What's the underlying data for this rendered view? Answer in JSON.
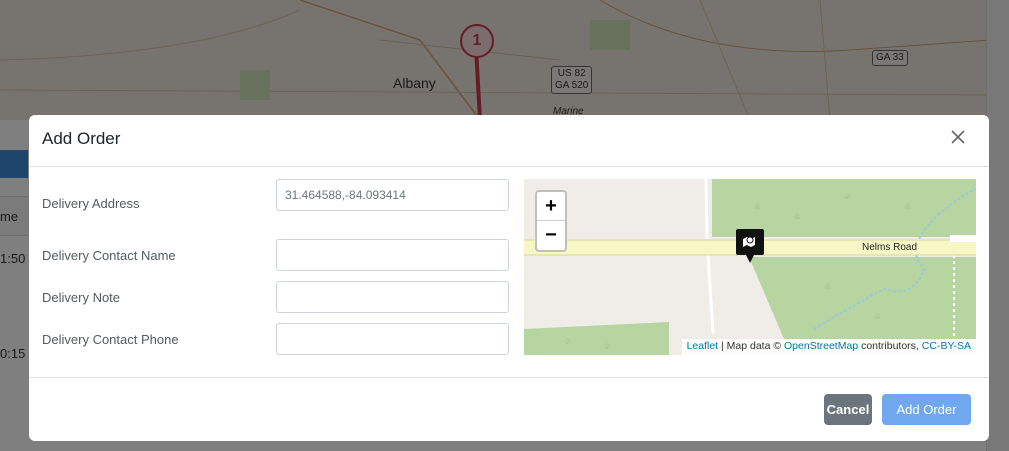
{
  "background": {
    "map_labels": {
      "city": "Albany",
      "shield1": "US 82",
      "shield2": "GA 520",
      "shield3": "GA 33",
      "place": "Marine",
      "marker_number": "1"
    },
    "table": {
      "col_header": "me",
      "row1_time": "1:50",
      "row2_time": "0:15"
    }
  },
  "modal": {
    "title": "Add Order",
    "close_icon": "close-icon",
    "fields": {
      "delivery_address": {
        "label": "Delivery Address",
        "value": "31.464588,-84.093414"
      },
      "contact_name": {
        "label": "Delivery Contact Name",
        "value": ""
      },
      "note": {
        "label": "Delivery Note",
        "value": ""
      },
      "contact_phone": {
        "label": "Delivery Contact Phone",
        "value": ""
      }
    },
    "map": {
      "zoom_in": "+",
      "zoom_out": "−",
      "road_label": "Nelms Road",
      "pin_icon": "map-marker-icon",
      "attribution": {
        "leaflet": "Leaflet",
        "separator": " | Map data © ",
        "osm": "OpenStreetMap",
        "contributors": " contributors, ",
        "license": "CC-BY-SA"
      }
    },
    "footer": {
      "cancel_label": "Cancel",
      "add_label": "Add Order"
    }
  },
  "colors": {
    "primary_button": "#6fa8ef",
    "secondary_button": "#6c757d",
    "park_green": "#b7d5a0",
    "road_yellow": "#f7f6c5"
  }
}
